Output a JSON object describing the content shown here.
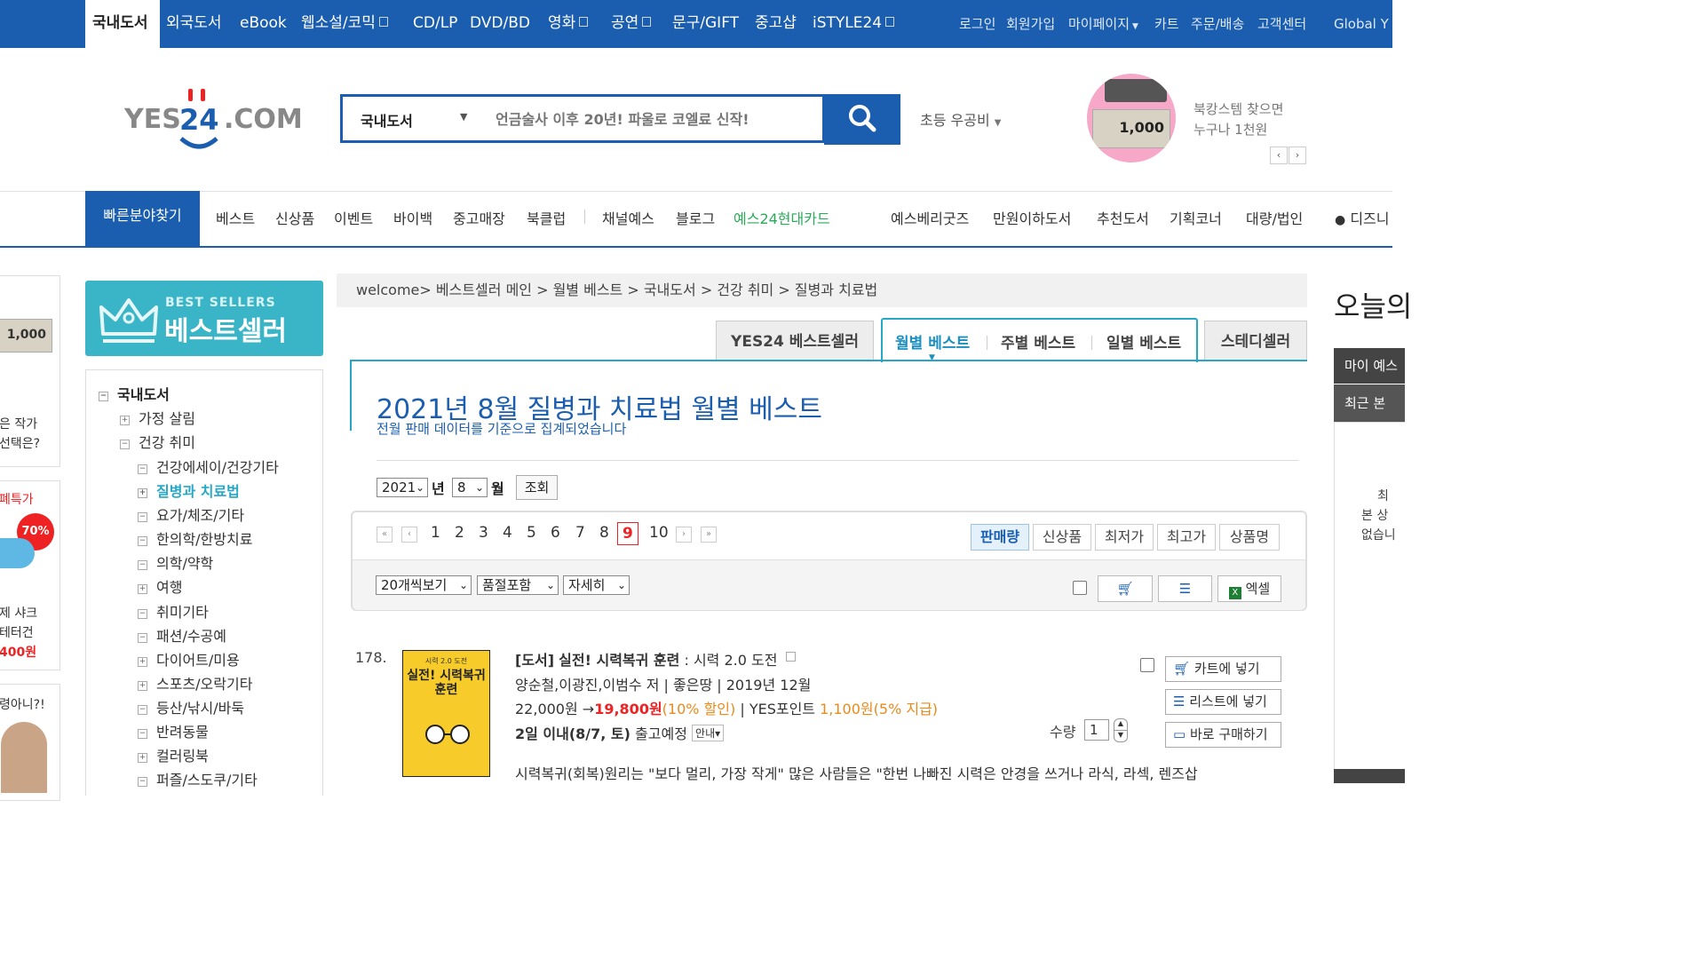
{
  "topbar": {
    "tabs": [
      "국내도서",
      "외국도서",
      "eBook",
      "웹소설/코믹",
      "CD/LP",
      "DVD/BD",
      "영화",
      "공연",
      "문구/GIFT",
      "중고샵",
      "iSTYLE24"
    ],
    "util": [
      "로그인",
      "회원가입",
      "마이페이지",
      "카트",
      "주문/배송",
      "고객센터",
      "Global Y"
    ]
  },
  "header": {
    "logo_text": "YES24.COM",
    "search_category": "국내도서",
    "search_placeholder": "언금술사 이후 20년! 파울로 코엘료 신작!",
    "shipping_label": "초등 우공비",
    "promo_card": "1,000",
    "promo_line1": "북캉스템 찾으면",
    "promo_line2": "누구나 1천원"
  },
  "nav": {
    "quick": "빠른분야찾기",
    "items": [
      "베스트",
      "신상품",
      "이벤트",
      "바이백",
      "중고매장",
      "북클럽",
      "채널예스",
      "블로그",
      "예스24현대카드",
      "예스베리굿즈",
      "만원이하도서",
      "추천도서",
      "기획코너",
      "대량/법인",
      "디즈니"
    ]
  },
  "left_edge": {
    "card": "1,000",
    "t1": "은 작가",
    "t2": "선택은?",
    "t3": "폐특가",
    "badge": "70%",
    "t4": "제 샤크",
    "t5": "테터건",
    "t6": "400원",
    "t7": "령아니?!"
  },
  "bestseller": {
    "en": "BEST SELLERS",
    "ko": "베스트셀러"
  },
  "categories": {
    "root": "국내도서",
    "c1": "가정 살림",
    "c2": "건강 취미",
    "subs": [
      "건강에세이/건강기타",
      "질병과 치료법",
      "요가/체조/기타",
      "한의학/한방치료",
      "의학/약학",
      "여행",
      "취미기타",
      "패션/수공예",
      "다이어트/미용",
      "스포츠/오락기타",
      "등산/낚시/바둑",
      "반려동물",
      "컬러링북",
      "퍼즐/스도쿠/기타"
    ]
  },
  "breadcrumb": "welcome> 베스트셀러 메인 > 월별 베스트 > 국내도서 > 건강 취미 > 질병과 치료법",
  "tabs": {
    "yes24": "YES24 베스트셀러",
    "monthly": "월별 베스트",
    "weekly": "주별 베스트",
    "daily": "일별 베스트",
    "steady": "스테디셀러"
  },
  "title": "2021년 8월 질병과 치료법 월별 베스트",
  "subtitle": "전월 판매 데이터를 기준으로 집계되었습니다",
  "filter": {
    "year": "2021",
    "year_label": "년",
    "month": "8",
    "month_label": "월",
    "query": "조회"
  },
  "pagination": {
    "pages": [
      "1",
      "2",
      "3",
      "4",
      "5",
      "6",
      "7",
      "8",
      "9",
      "10"
    ],
    "current": "9"
  },
  "sort": [
    "판매량",
    "신상품",
    "최저가",
    "최고가",
    "상품명"
  ],
  "view": {
    "per_page": "20개씩보기",
    "soldout": "품절포함",
    "detail": "자세히",
    "excel": "엑셀"
  },
  "product": {
    "rank": "178.",
    "cover_small": "시력 2.0 도전",
    "cover_title": "실전! 시력복귀 훈련",
    "type": "[도서]",
    "title": "실전! 시력복귀 훈련",
    "subtitle": " : 시력 2.0 도전",
    "authors": "양순철,이광진,이범수 저 | 좋은땅 | 2019년 12월",
    "list_price": "22,000원 →",
    "sale_price": "19,800원",
    "discount": "(10% 할인)",
    "point_label": " | YES포인트 ",
    "point": "1,100원",
    "point_rate": "(5% 지급)",
    "delivery": "2일 이내(8/7, 토)",
    "delivery_note": " 출고예정",
    "guide": "안내",
    "qty_label": "수량",
    "qty": "1",
    "cart": "카트에 넣기",
    "list": "리스트에 넣기",
    "buy": "바로 구매하기",
    "description": "시력복귀(회복)원리는 \"보다 멀리, 가장 작게\" 많은 사람들은 \"한번 나빠진 시력은 안경을 쓰거나 라식, 라섹, 렌즈삽"
  },
  "right_col": {
    "today": "오늘의",
    "dark1": "마이 예스",
    "dark2": "최근 본",
    "t1": "최",
    "t2": "본 상",
    "t3": "없습니"
  },
  "colors": {
    "brand_blue": "#1b5eb0",
    "teal": "#27a7c6",
    "price_red": "#e22222",
    "point_orange": "#e98a1b"
  }
}
